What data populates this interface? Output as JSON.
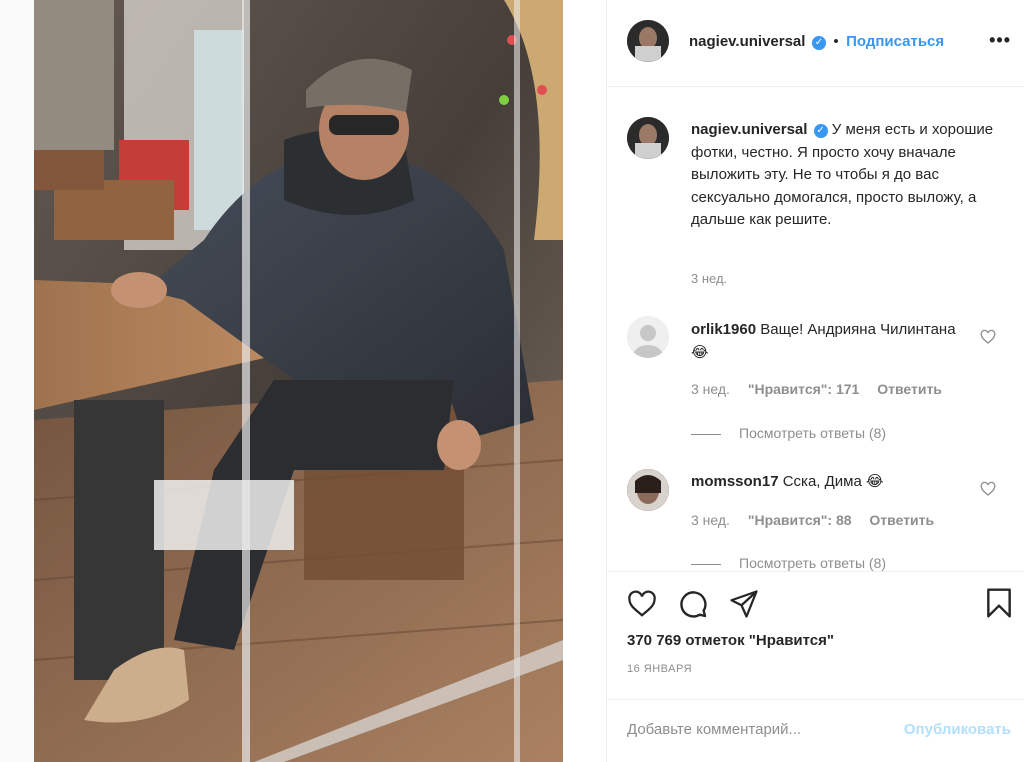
{
  "post": {
    "author": "nagiev.universal",
    "follow_label": "Подписаться",
    "more_icon": "more-horizontal-icon",
    "dot": "•"
  },
  "caption": {
    "author": "nagiev.universal",
    "text": "У меня есть и хорошие фотки, честно. Я просто хочу вначале выложить эту. Не то чтобы я до вас сексуально домогался, просто выложу, а дальше как решите.",
    "time": "3 нед."
  },
  "comments": [
    {
      "author": "orlik1960",
      "text": "Ваще! Андрияна Чилинтана😂",
      "time": "3 нед.",
      "likes": "\"Нравится\": 171",
      "reply": "Ответить",
      "view_replies": "Посмотреть ответы (8)"
    },
    {
      "author": "momsson17",
      "text": "Сска, Дима 😂",
      "time": "3 нед.",
      "likes": "\"Нравится\": 88",
      "reply": "Ответить",
      "view_replies": "Посмотреть ответы (8)"
    }
  ],
  "footer": {
    "likes": "370 769 отметок \"Нравится\"",
    "date": "16 ЯНВАРЯ",
    "comment_placeholder": "Добавьте комментарий...",
    "publish_label": "Опубликовать"
  },
  "colors": {
    "accent": "#3897f0",
    "muted": "#8e8e8e",
    "publish_disabled": "#b2dffc"
  }
}
